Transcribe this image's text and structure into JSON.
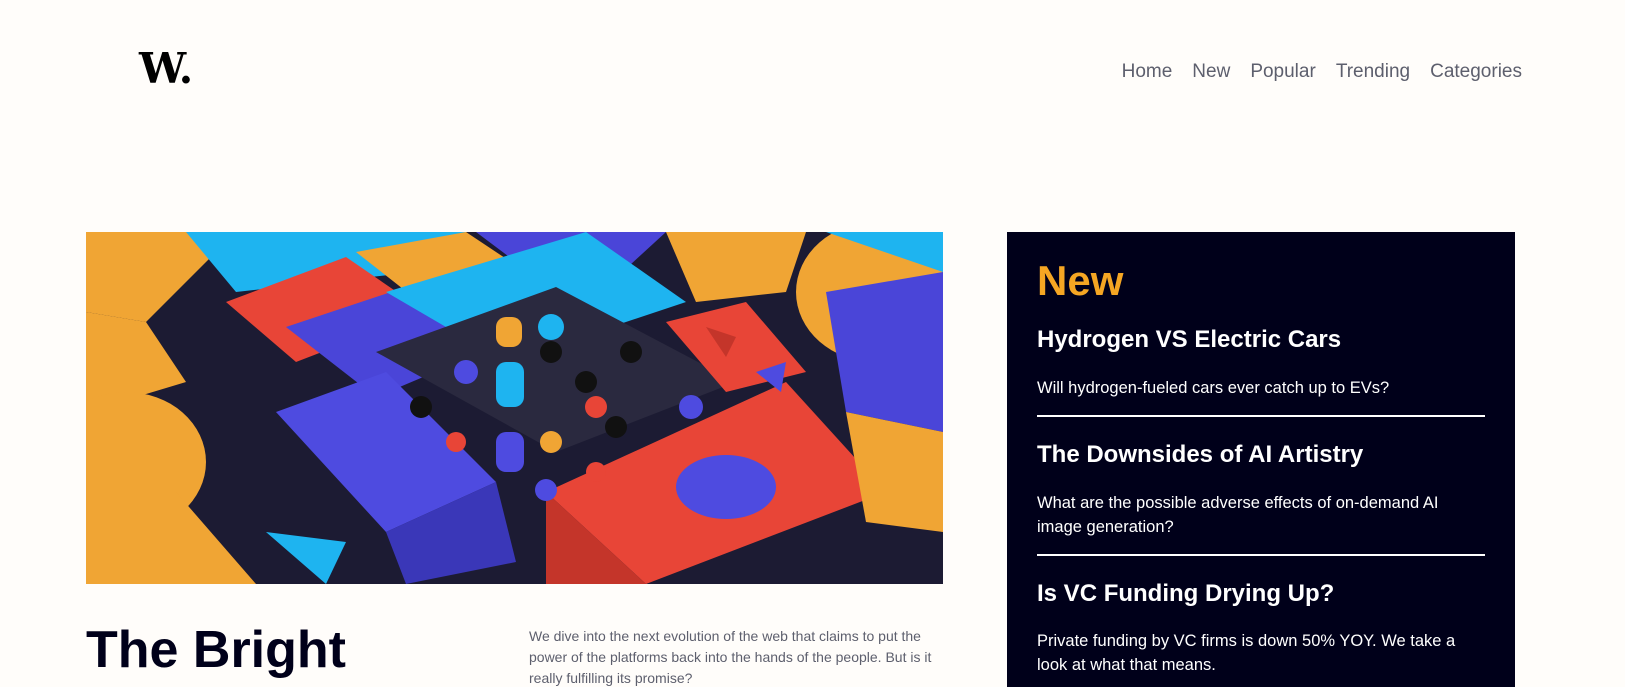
{
  "brand": {
    "logo": "W."
  },
  "nav": {
    "items": [
      "Home",
      "New",
      "Popular",
      "Trending",
      "Categories"
    ]
  },
  "feature": {
    "headline": "The Bright",
    "lede": "We dive into the next evolution of the web that claims to put the power of the platforms back into the hands of the people. But is it really fulfilling its promise?"
  },
  "sidebar": {
    "title": "New",
    "items": [
      {
        "title": "Hydrogen VS Electric Cars",
        "desc": "Will hydrogen-fueled cars ever catch up to EVs?"
      },
      {
        "title": "The Downsides of AI Artistry",
        "desc": "What are the possible adverse effects of on-demand AI image generation?"
      },
      {
        "title": "Is VC Funding Drying Up?",
        "desc": "Private funding by VC firms is down 50% YOY. We take a look at what that means."
      }
    ]
  },
  "colors": {
    "accent": "#f5a623",
    "dark": "#00001a",
    "muted": "#5d5f6d"
  }
}
